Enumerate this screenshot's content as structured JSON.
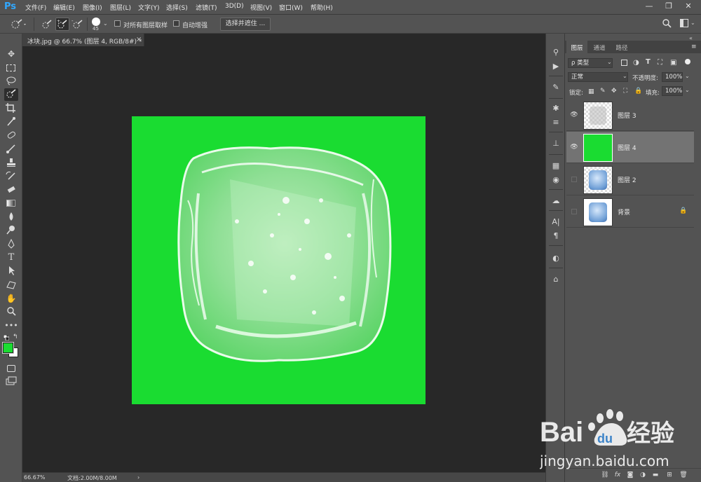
{
  "app": {
    "logo": "Ps",
    "menu": [
      "文件(F)",
      "编辑(E)",
      "图像(I)",
      "图层(L)",
      "文字(Y)",
      "选择(S)",
      "滤镜(T)",
      "3D(D)",
      "视图(V)",
      "窗口(W)",
      "帮助(H)"
    ],
    "window_controls": [
      "—",
      "❐",
      "✕"
    ]
  },
  "options": {
    "brush_size": "45",
    "sample_all_layers": "对所有图层取样",
    "auto_enhance": "自动增强",
    "refine_button": "选择并遮住 ..."
  },
  "document": {
    "tab_title": "冰块.jpg @ 66.7% (图层 4, RGB/8#) *",
    "tab_close": "×",
    "canvas_color": "#1adc31"
  },
  "status": {
    "zoom": "66.67%",
    "doc_info": "文档:2.00M/8.00M",
    "arrow": "›"
  },
  "layers_panel": {
    "tabs": [
      "图层",
      "通道",
      "路径"
    ],
    "filter_kind": "ρ 类型",
    "blend_mode": "正常",
    "opacity_label": "不透明度:",
    "opacity_value": "100%",
    "lock_label": "锁定:",
    "fill_label": "填充:",
    "fill_value": "100%",
    "layers": [
      {
        "name": "图层 3",
        "visible": true,
        "selected": false,
        "thumb": "transparent-ice"
      },
      {
        "name": "图层 4",
        "visible": true,
        "selected": true,
        "thumb": "green"
      },
      {
        "name": "图层 2",
        "visible": false,
        "selected": false,
        "thumb": "ice"
      },
      {
        "name": "背景",
        "visible": false,
        "selected": false,
        "thumb": "ice",
        "locked": true
      }
    ],
    "bottom_icons": [
      "link-icon",
      "fx-icon",
      "mask-icon",
      "adjustment-icon",
      "folder-icon",
      "new-layer-icon",
      "trash-icon"
    ],
    "fx_label": "fx"
  },
  "watermark": {
    "brand": "Bai",
    "brand2": "du",
    "brand_cn": "经验",
    "url": "jingyan.baidu.com"
  }
}
